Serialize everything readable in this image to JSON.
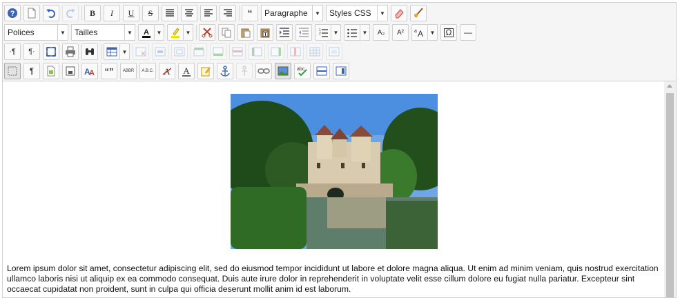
{
  "toolbar": {
    "format_select": "Paragraphe",
    "styles_select": "Styles CSS",
    "font_select": "Polices",
    "size_select": "Tailles",
    "bold_label": "B",
    "italic_label": "I",
    "underline_label": "U",
    "strike_label": "S",
    "blockquote_label": "“",
    "subscript_label": "A₂",
    "superscript_label": "A²",
    "abbr_label": "ABBR",
    "acronym_label": "A.B.C.",
    "quote_label": "“”",
    "pilcrow_label": "¶",
    "ltr_label": "·¶",
    "rtl_label": "¶·",
    "omega_label": "Ω",
    "hr_label": "—",
    "icons": [
      "help-icon",
      "new-page-icon",
      "undo-icon",
      "redo-icon",
      "justify-icon",
      "center-icon",
      "left-icon",
      "right-icon",
      "eraser-icon",
      "brush-icon",
      "text-color-icon",
      "highlight-icon",
      "cut-icon",
      "copy-icon",
      "paste-icon",
      "paste-word-icon",
      "indent-icon",
      "outdent-icon",
      "ordered-list-icon",
      "unordered-list-icon",
      "font-size-icon",
      "fullscreen-icon",
      "print-icon",
      "find-icon",
      "table-icon",
      "show-blocks-icon",
      "template-icon",
      "save-icon",
      "anchor-icon",
      "unlink-icon",
      "link-icon",
      "image-icon",
      "spellcheck-icon",
      "horizontal-rule-icon",
      "media-icon"
    ]
  },
  "content": {
    "image_alt": "",
    "paragraph": "Lorem ipsum dolor sit amet, consectetur adipiscing elit, sed do eiusmod tempor incididunt ut labore et dolore magna aliqua. Ut enim ad minim veniam, quis nostrud exercitation ullamco laboris nisi ut aliquip ex ea commodo consequat. Duis aute irure dolor in reprehenderit in voluptate velit esse cillum dolore eu fugiat nulla pariatur. Excepteur sint occaecat cupidatat non proident, sunt in culpa qui officia deserunt mollit anim id est laborum."
  }
}
